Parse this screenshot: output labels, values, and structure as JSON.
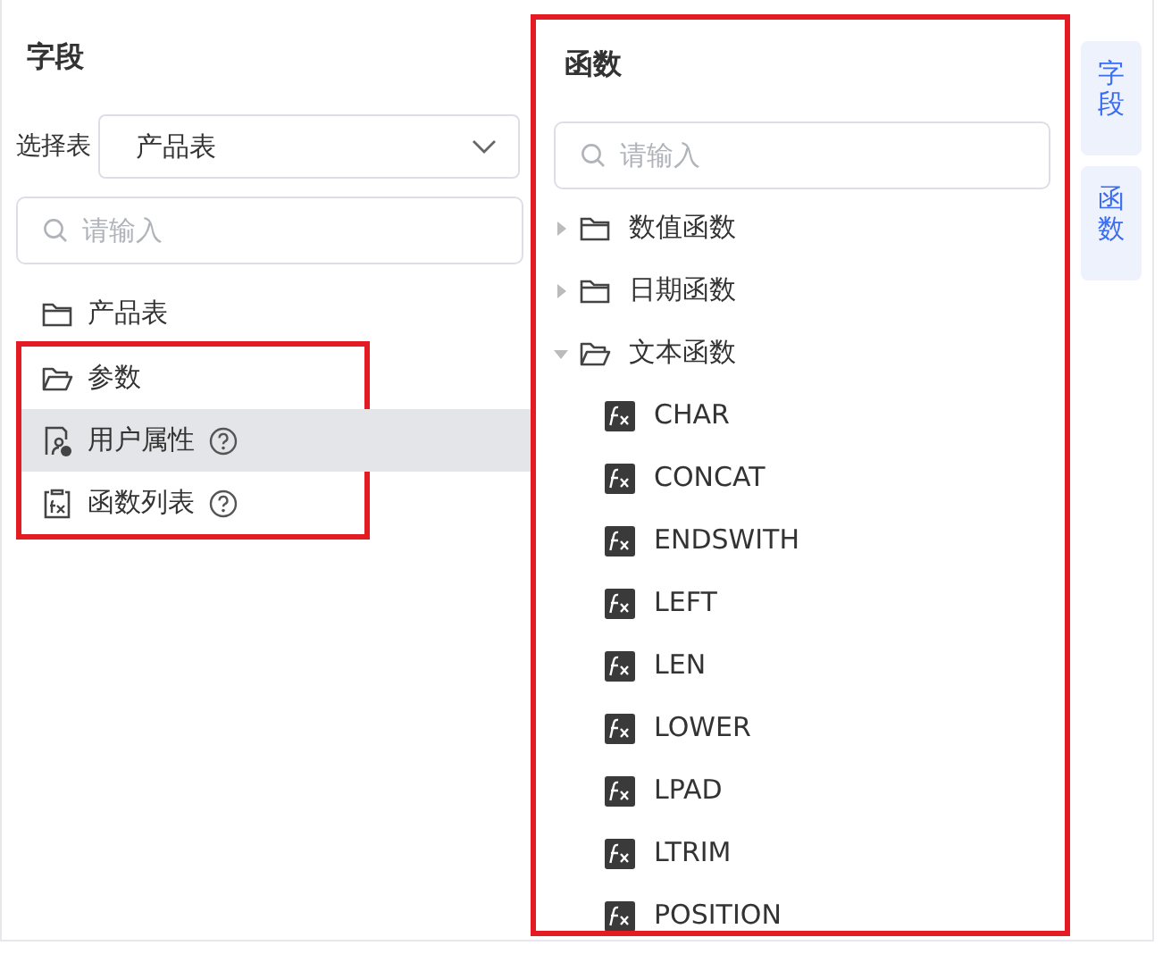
{
  "fields_panel": {
    "title": "字段",
    "table_select": {
      "label": "选择表",
      "value": "产品表"
    },
    "search": {
      "placeholder": "请输入"
    },
    "items": [
      {
        "label": "产品表",
        "kind": "folder",
        "selected": false,
        "help": false,
        "highlighted": false
      },
      {
        "label": "参数",
        "kind": "folder_open",
        "selected": false,
        "help": false,
        "highlighted": true
      },
      {
        "label": "用户属性",
        "kind": "user_attribute",
        "selected": true,
        "help": true,
        "highlighted": true
      },
      {
        "label": "函数列表",
        "kind": "function_list",
        "selected": false,
        "help": true,
        "highlighted": true
      }
    ]
  },
  "functions_panel": {
    "title": "函数",
    "highlighted": true,
    "search": {
      "placeholder": "请输入"
    },
    "categories": [
      {
        "label": "数值函数",
        "expanded": false
      },
      {
        "label": "日期函数",
        "expanded": false
      },
      {
        "label": "文本函数",
        "expanded": true,
        "children": [
          {
            "label": "CHAR"
          },
          {
            "label": "CONCAT"
          },
          {
            "label": "ENDSWITH"
          },
          {
            "label": "LEFT"
          },
          {
            "label": "LEN"
          },
          {
            "label": "LOWER"
          },
          {
            "label": "LPAD"
          },
          {
            "label": "LTRIM"
          },
          {
            "label": "POSITION"
          }
        ]
      }
    ]
  },
  "side_tabs": [
    {
      "label": "字段",
      "selected": false
    },
    {
      "label": "函数",
      "selected": false
    }
  ]
}
